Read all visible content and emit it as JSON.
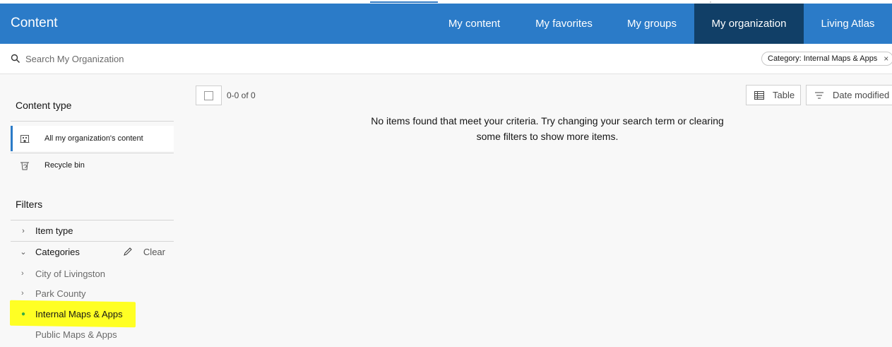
{
  "header": {
    "title": "Content",
    "tabs": [
      {
        "label": "My content",
        "active": false
      },
      {
        "label": "My favorites",
        "active": false
      },
      {
        "label": "My groups",
        "active": false
      },
      {
        "label": "My organization",
        "active": true
      },
      {
        "label": "Living Atlas",
        "active": false
      }
    ]
  },
  "search": {
    "placeholder": "Search My Organization",
    "filter_chip": "Category: Internal Maps & Apps",
    "chip_close": "×"
  },
  "sidebar": {
    "content_type_title": "Content type",
    "content_types": [
      {
        "label": "All my organization's content",
        "icon": "building-icon",
        "selected": true
      },
      {
        "label": "Recycle bin",
        "icon": "recycle-bin-icon",
        "selected": false
      }
    ],
    "filters_title": "Filters",
    "item_type_label": "Item type",
    "categories_label": "Categories",
    "clear_label": "Clear",
    "categories": [
      {
        "label": "City of Livingston",
        "expandable": true,
        "active": false
      },
      {
        "label": "Park County",
        "expandable": true,
        "active": false
      },
      {
        "label": "Internal Maps & Apps",
        "expandable": false,
        "active": true
      },
      {
        "label": "Public Maps & Apps",
        "expandable": false,
        "active": false
      }
    ]
  },
  "results": {
    "count_text": "0-0 of 0",
    "view_label": "Table",
    "sort_label": "Date modified",
    "empty_message": "No items found that meet your criteria. Try changing your search term or clearing some filters to show more items."
  },
  "colors": {
    "header_bg": "#2b7bc8",
    "active_tab_bg": "#113f67",
    "highlight": "#ffff24"
  }
}
